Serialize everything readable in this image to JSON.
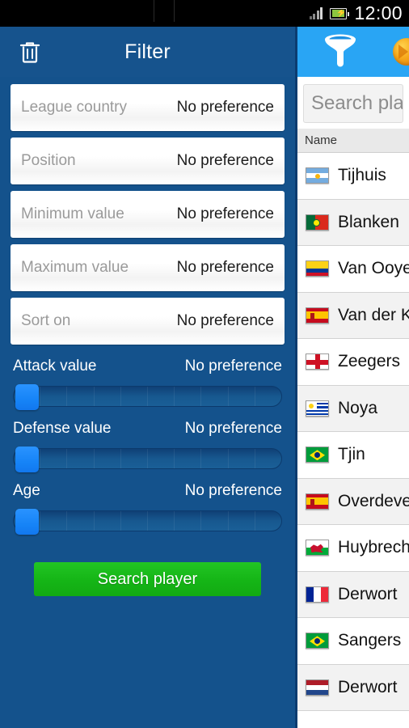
{
  "status_bar": {
    "time": "12:00",
    "signal_icon": "signal-bars-icon",
    "battery_icon": "battery-charging-icon"
  },
  "filter_panel": {
    "title": "Filter",
    "delete_icon": "trash-icon",
    "rows": [
      {
        "label": "League country",
        "value": "No preference"
      },
      {
        "label": "Position",
        "value": "No preference"
      },
      {
        "label": "Minimum value",
        "value": "No preference"
      },
      {
        "label": "Maximum value",
        "value": "No preference"
      },
      {
        "label": "Sort on",
        "value": "No preference"
      }
    ],
    "sliders": [
      {
        "label": "Attack value",
        "value": "No preference",
        "position_pct": 0
      },
      {
        "label": "Defense value",
        "value": "No preference",
        "position_pct": 0
      },
      {
        "label": "Age",
        "value": "No preference",
        "position_pct": 0
      }
    ],
    "search_button": "Search player"
  },
  "player_panel": {
    "funnel_icon": "funnel-filter-icon",
    "account_icon": "orange-account-icon",
    "search_placeholder": "Search player",
    "search_value": "",
    "column_header": "Name",
    "rows": [
      {
        "name": "Tijhuis",
        "country": "Argentina"
      },
      {
        "name": "Blanken",
        "country": "Portugal"
      },
      {
        "name": "Van Ooyen",
        "country": "Colombia"
      },
      {
        "name": "Van der Kro",
        "country": "Spain"
      },
      {
        "name": "Zeegers",
        "country": "England"
      },
      {
        "name": "Noya",
        "country": "Uruguay"
      },
      {
        "name": "Tjin",
        "country": "Brazil"
      },
      {
        "name": "Overdevest",
        "country": "Spain"
      },
      {
        "name": "Huybrechts",
        "country": "Wales"
      },
      {
        "name": "Derwort",
        "country": "France"
      },
      {
        "name": "Sangers",
        "country": "Brazil"
      },
      {
        "name": "Derwort",
        "country": "Netherlands"
      }
    ]
  },
  "colors": {
    "header_blue": "#16538d",
    "background_blue": "#14528c",
    "accent_blue": "#29a5f4",
    "slider_thumb": "#1684f7",
    "search_green": "#15b516"
  }
}
